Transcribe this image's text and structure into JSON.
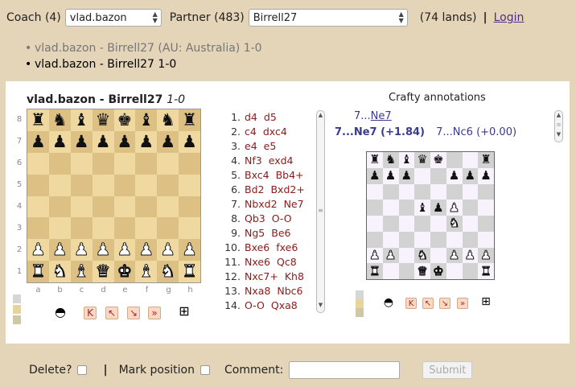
{
  "header": {
    "coach_label": "Coach (4)",
    "coach_value": "vlad.bazon",
    "partner_label": "Partner (483)",
    "partner_value": "Birrell27",
    "lands_text": "(74 lands)",
    "separator": "|",
    "login_label": "Login"
  },
  "games": [
    {
      "bullet": "•",
      "text": "vlad.bazon - Birrell27 (AU: Australia) 1-0"
    },
    {
      "bullet": "•",
      "text": "vlad.bazon - Birrell27 1-0"
    }
  ],
  "board": {
    "title": "vlad.bazon - Birrell27",
    "result": "1-0",
    "ranks": [
      "8",
      "7",
      "6",
      "5",
      "4",
      "3",
      "2",
      "1"
    ],
    "files": [
      "a",
      "b",
      "c",
      "d",
      "e",
      "f",
      "g",
      "h"
    ],
    "position": [
      [
        "bR",
        "bN",
        "bB",
        "bQ",
        "bK",
        "bB",
        "bN",
        "bR"
      ],
      [
        "bP",
        "bP",
        "bP",
        "bP",
        "bP",
        "bP",
        "bP",
        "bP"
      ],
      [
        "",
        "",
        "",
        "",
        "",
        "",
        "",
        ""
      ],
      [
        "",
        "",
        "",
        "",
        "",
        "",
        "",
        ""
      ],
      [
        "",
        "",
        "",
        "",
        "",
        "",
        "",
        ""
      ],
      [
        "",
        "",
        "",
        "",
        "",
        "",
        "",
        ""
      ],
      [
        "wP",
        "wP",
        "wP",
        "wP",
        "wP",
        "wP",
        "wP",
        "wP"
      ],
      [
        "wR",
        "wN",
        "wB",
        "wQ",
        "wK",
        "wB",
        "wN",
        "wR"
      ]
    ]
  },
  "controls": {
    "flip_icon": "◓",
    "first_icon": "K",
    "prev_icon": "↖",
    "next_icon": "↘",
    "last_icon": "»",
    "expand_icon": "⊞"
  },
  "moves": [
    {
      "num": "1.",
      "w": "d4",
      "b": "d5"
    },
    {
      "num": "2.",
      "w": "c4",
      "b": "dxc4"
    },
    {
      "num": "3.",
      "w": "e4",
      "b": "e5"
    },
    {
      "num": "4.",
      "w": "Nf3",
      "b": "exd4"
    },
    {
      "num": "5.",
      "w": "Bxc4",
      "b": "Bb4+"
    },
    {
      "num": "6.",
      "w": "Bd2",
      "b": "Bxd2+"
    },
    {
      "num": "7.",
      "w": "Nbxd2",
      "b": "Ne7"
    },
    {
      "num": "8.",
      "w": "Qb3",
      "b": "O-O"
    },
    {
      "num": "9.",
      "w": "Ng5",
      "b": "Be6"
    },
    {
      "num": "10.",
      "w": "Bxe6",
      "b": "fxe6"
    },
    {
      "num": "11.",
      "w": "Nxe6",
      "b": "Qc8"
    },
    {
      "num": "12.",
      "w": "Nxc7+",
      "b": "Kh8"
    },
    {
      "num": "13.",
      "w": "Nxa8",
      "b": "Nbc6"
    },
    {
      "num": "14.",
      "w": "O-O",
      "b": "Qxa8"
    }
  ],
  "annotations": {
    "title": "Crafty annotations",
    "line1_prefix": "7...",
    "line1_move": "Ne7",
    "line2_main": "7...Ne7 (+1.84)",
    "line2_alt": "7...Nc6 (+0.00)",
    "position": [
      [
        "bR",
        "bN",
        "bB",
        "bQ",
        "bK",
        "",
        "",
        "bR"
      ],
      [
        "bP",
        "bP",
        "bP",
        "",
        "",
        "bP",
        "bP",
        "bP"
      ],
      [
        "",
        "",
        "",
        "",
        "",
        "",
        "",
        ""
      ],
      [
        "",
        "",
        "",
        "bB",
        "bP",
        "wP",
        "",
        ""
      ],
      [
        "",
        "",
        "",
        "",
        "",
        "wN",
        "",
        ""
      ],
      [
        "",
        "",
        "",
        "",
        "",
        "",
        "",
        ""
      ],
      [
        "wP",
        "wP",
        "",
        "wN",
        "",
        "wP",
        "wP",
        "wP"
      ],
      [
        "wR",
        "",
        "",
        "wQ",
        "wK",
        "",
        "",
        "wR"
      ]
    ]
  },
  "footer": {
    "delete_label": "Delete?",
    "sep": "|",
    "mark_label": "Mark position",
    "comment_label": "Comment:",
    "submit_label": "Submit"
  },
  "colors": {
    "background": "#e4d4b8",
    "light_square": "#f0d9a0",
    "dark_square": "#ddc184",
    "move_color": "#8b1a1a",
    "annotation_color": "#3a3a8a"
  }
}
